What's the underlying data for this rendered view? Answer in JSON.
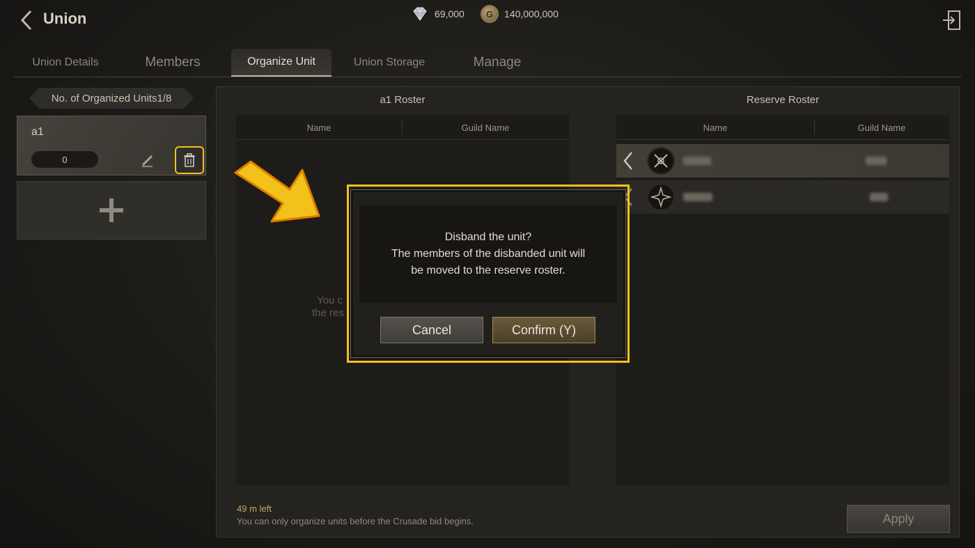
{
  "header": {
    "title": "Union",
    "gems": "69,000",
    "gold": "140,000,000",
    "gold_icon_letter": "G"
  },
  "tabs": [
    {
      "label": "Union Details"
    },
    {
      "label": "Members"
    },
    {
      "label": "Organize Unit"
    },
    {
      "label": "Union Storage"
    },
    {
      "label": "Manage"
    }
  ],
  "sidebar": {
    "count_label": "No. of Organized Units1/8",
    "unit": {
      "name": "a1",
      "member_count": "0"
    }
  },
  "unit_roster": {
    "title": "a1 Roster",
    "columns": [
      "Name",
      "Guild Name"
    ],
    "empty_line1": "You c",
    "empty_line2": "the res"
  },
  "reserve_roster": {
    "title": "Reserve Roster",
    "columns": [
      "Name",
      "Guild Name"
    ]
  },
  "footer": {
    "time_left": "49 m left",
    "notice": "You can only organize units before the Crusade bid begins.",
    "apply_label": "Apply"
  },
  "dialog": {
    "line1": "Disband the unit?",
    "line2": "The members of the disbanded unit will",
    "line3": "be moved to the reserve roster.",
    "cancel_label": "Cancel",
    "confirm_label": "Confirm (Y)"
  },
  "colors": {
    "highlight": "#f2c21a",
    "background": "#1b1a17"
  }
}
